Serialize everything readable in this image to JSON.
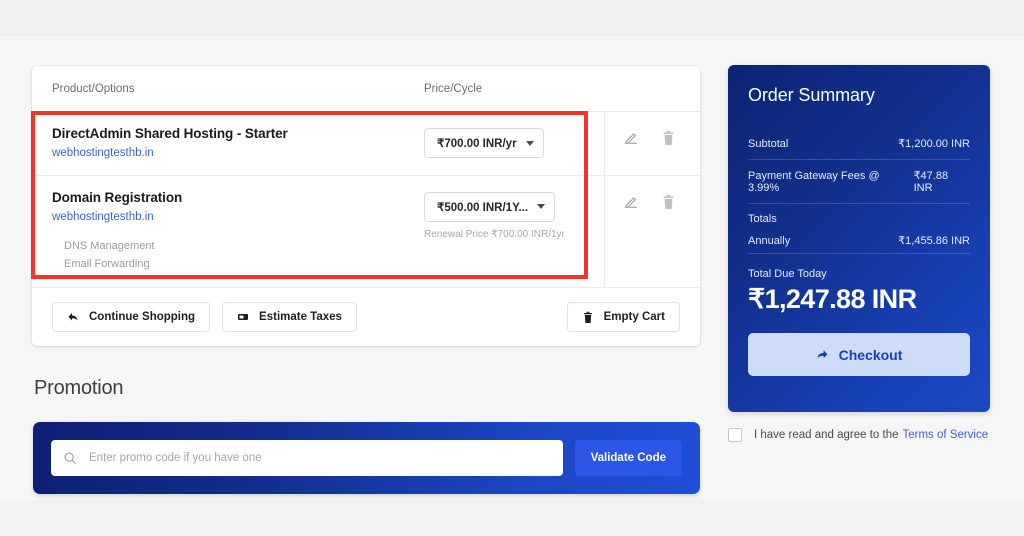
{
  "cart": {
    "columns": {
      "product": "Product/Options",
      "price": "Price/Cycle"
    },
    "items": [
      {
        "title": "DirectAdmin Shared Hosting - Starter",
        "domain": "webhostingtesthb.in",
        "cycle": "₹700.00 INR/yr",
        "renewal": "",
        "options": []
      },
      {
        "title": "Domain Registration",
        "domain": "webhostingtesthb.in",
        "cycle": "₹500.00 INR/1Y...",
        "renewal": "Renewal Price ₹700.00 INR/1yr",
        "options": [
          "DNS Management",
          "Email Forwarding"
        ]
      }
    ],
    "actions": {
      "edit_icon": "pencil-icon",
      "delete_icon": "trash-icon"
    },
    "footer": {
      "continue_shopping": "Continue Shopping",
      "estimate_taxes": "Estimate Taxes",
      "empty_cart": "Empty Cart"
    }
  },
  "promotion": {
    "heading": "Promotion",
    "placeholder": "Enter promo code if you have one",
    "value": "",
    "validate_label": "Validate Code",
    "search_icon": "search-icon"
  },
  "summary": {
    "title": "Order Summary",
    "rows": [
      {
        "label": "Subtotal",
        "value": "₹1,200.00 INR"
      },
      {
        "label": "Payment Gateway Fees @ 3.99%",
        "value": "₹47.88 INR"
      }
    ],
    "totals_label": "Totals",
    "totals_period": "Annually",
    "totals_value": "₹1,455.86 INR",
    "due_label": "Total Due Today",
    "due_value": "₹1,247.88 INR",
    "checkout_label": "Checkout"
  },
  "terms": {
    "text": "I have read and agree to the",
    "link": "Terms of Service",
    "checked": false
  },
  "colors": {
    "brand_navy": "#0e2472",
    "brand_blue": "#1a49c6",
    "accent_button": "#2d55e8",
    "checkout_bg": "#cddcf7",
    "link": "#3f64c4",
    "highlight": "#f0342b",
    "page_bg": "#f6f6f6"
  }
}
